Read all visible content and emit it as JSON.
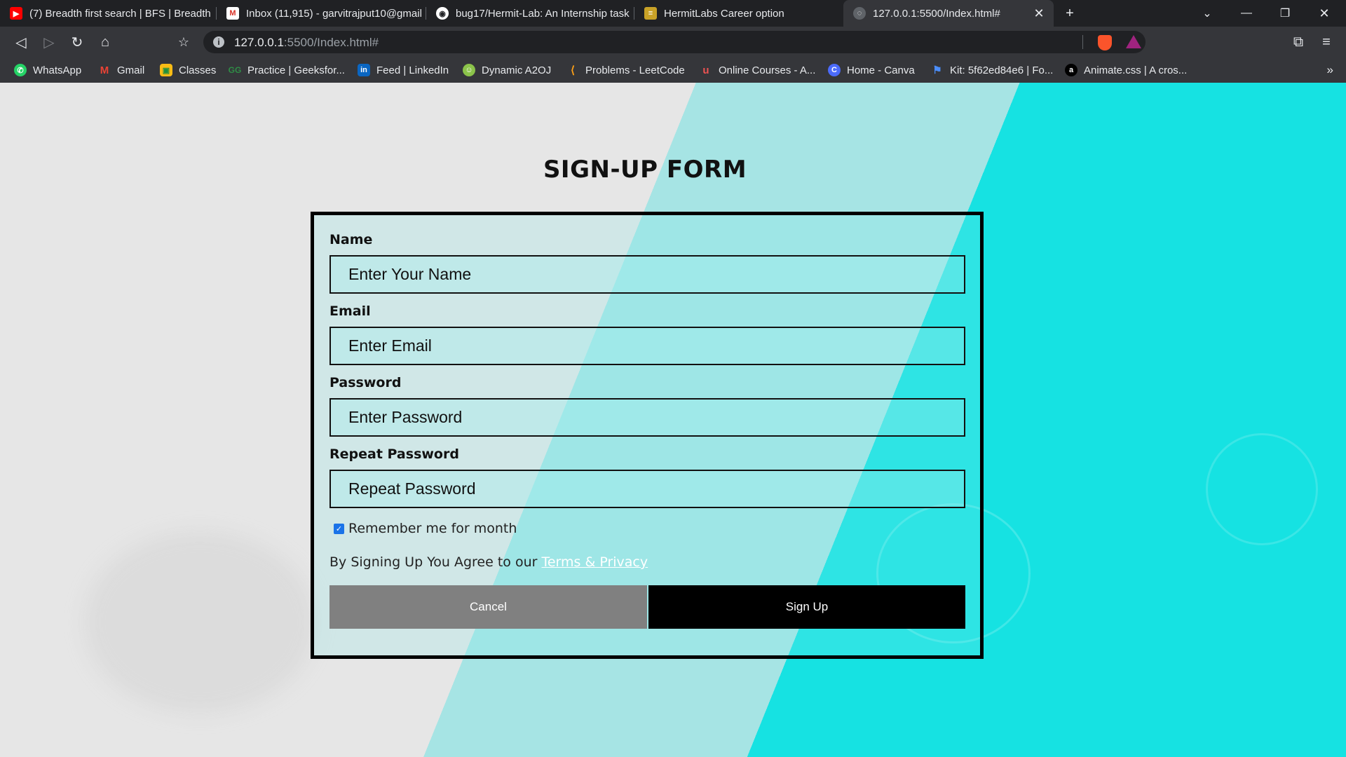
{
  "browser": {
    "tabs": [
      {
        "title": "(7) Breadth first search | BFS | Breadth",
        "icon": "youtube-icon"
      },
      {
        "title": "Inbox (11,915) - garvitrajput10@gmail",
        "icon": "gmail-icon"
      },
      {
        "title": "bug17/Hermit-Lab: An Internship task",
        "icon": "github-icon"
      },
      {
        "title": "HermitLabs Career option",
        "icon": "hermitlabs-icon"
      },
      {
        "title": "127.0.0.1:5500/Index.html#",
        "icon": "globe-icon",
        "active": true
      }
    ],
    "url": {
      "host": "127.0.0.1",
      "rest": ":5500/Index.html#"
    },
    "bookmarks": [
      {
        "label": "WhatsApp",
        "icon": "whatsapp-icon"
      },
      {
        "label": "Gmail",
        "icon": "gmail-icon"
      },
      {
        "label": "Classes",
        "icon": "classroom-icon"
      },
      {
        "label": "Practice | Geeksfor...",
        "icon": "geeksforgeeks-icon"
      },
      {
        "label": "Feed | LinkedIn",
        "icon": "linkedin-icon"
      },
      {
        "label": "Dynamic A2OJ",
        "icon": "a2oj-icon"
      },
      {
        "label": "Problems - LeetCode",
        "icon": "leetcode-icon"
      },
      {
        "label": "Online Courses - A...",
        "icon": "udemy-icon"
      },
      {
        "label": "Home - Canva",
        "icon": "canva-icon"
      },
      {
        "label": "Kit: 5f62ed84e6 | Fo...",
        "icon": "flag-icon"
      },
      {
        "label": "Animate.css | A cros...",
        "icon": "animate-icon"
      }
    ]
  },
  "page": {
    "heading": "SIGN-UP FORM",
    "fields": [
      {
        "label": "Name",
        "placeholder": "Enter Your Name"
      },
      {
        "label": "Email",
        "placeholder": "Enter Email"
      },
      {
        "label": "Password",
        "placeholder": "Enter Password"
      },
      {
        "label": "Repeat Password",
        "placeholder": "Repeat Password"
      }
    ],
    "remember": {
      "label": "Remember me for month",
      "checked": true
    },
    "terms": {
      "text": "By Signing Up You Agree to our ",
      "link": "Terms & Privacy"
    },
    "buttons": {
      "cancel": "Cancel",
      "signup": "Sign Up"
    }
  },
  "colors": {
    "cancel_button": "#808080",
    "signup_button": "#000000",
    "accent_cyan": "#16e2e2",
    "terms_link": "#ffffff"
  }
}
